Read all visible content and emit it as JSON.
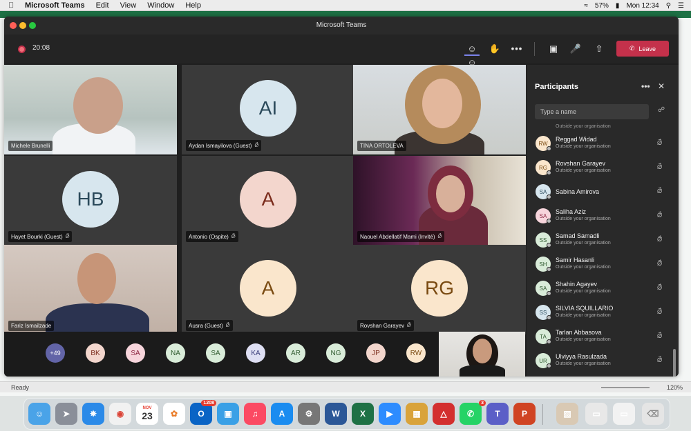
{
  "menubar": {
    "app_name": "Microsoft Teams",
    "menus": [
      "Edit",
      "View",
      "Window",
      "Help"
    ],
    "battery": "57%",
    "clock": "Mon 12:34"
  },
  "window": {
    "title": "Microsoft Teams"
  },
  "toolbar": {
    "timer": "20:08",
    "leave_label": "Leave"
  },
  "tiles": [
    {
      "name": "Michele Brunelli",
      "type": "video",
      "muted": false
    },
    {
      "name": "Aydan Ismayilova (Guest)",
      "type": "avatar",
      "initials": "AI",
      "muted": true,
      "bg": "#d7e6ee",
      "fg": "#2b4a5b"
    },
    {
      "name": "TINA ORTOLEVA",
      "type": "video",
      "muted": false
    },
    {
      "name": "Hayet Bourki (Guest)",
      "type": "avatar",
      "initials": "HB",
      "muted": true,
      "bg": "#d7e6ee",
      "fg": "#2b4a5b"
    },
    {
      "name": "Antonio (Ospite)",
      "type": "avatar",
      "initials": "A",
      "muted": true,
      "bg": "#f3d6cd",
      "fg": "#7a2b1b"
    },
    {
      "name": "Naouel Abdellatif Mami (Invité)",
      "type": "video",
      "muted": true
    },
    {
      "name": "Fariz Ismailzade",
      "type": "video",
      "muted": false
    },
    {
      "name": "Ausra (Guest)",
      "type": "avatar",
      "initials": "A",
      "muted": true,
      "bg": "#fae6cc",
      "fg": "#7a4b12"
    },
    {
      "name": "Rovshan Garayev",
      "type": "avatar",
      "initials": "RG",
      "muted": true,
      "bg": "#fae6cc",
      "fg": "#7a4b12"
    }
  ],
  "strip": {
    "overflow": "+49",
    "avatars": [
      {
        "initials": "BK",
        "bg": "#f3d6cd",
        "fg": "#7a2b1b"
      },
      {
        "initials": "SA",
        "bg": "#f7d5dc",
        "fg": "#8a2440"
      },
      {
        "initials": "NA",
        "bg": "#d9ecd9",
        "fg": "#2f5a2f"
      },
      {
        "initials": "SA",
        "bg": "#d9ecd9",
        "fg": "#2f5a2f"
      },
      {
        "initials": "KA",
        "bg": "#dedff3",
        "fg": "#3b3e7a"
      },
      {
        "initials": "AR",
        "bg": "#d9ecd9",
        "fg": "#2f5a2f"
      },
      {
        "initials": "NG",
        "bg": "#d9ecd9",
        "fg": "#2f5a2f"
      },
      {
        "initials": "JP",
        "bg": "#f3d6cd",
        "fg": "#7a2b1b"
      },
      {
        "initials": "RW",
        "bg": "#fae6cc",
        "fg": "#7a4b12"
      }
    ]
  },
  "panel": {
    "title": "Participants",
    "search_placeholder": "Type a name",
    "cut_off_text": "Outside your organisation",
    "participants": [
      {
        "initials": "RW",
        "name": "Reggad Widad",
        "sub": "Outside your organisation",
        "bg": "#fae6cc",
        "fg": "#7a4b12"
      },
      {
        "initials": "RG",
        "name": "Rovshan Garayev",
        "sub": "Outside your organisation",
        "bg": "#fae6cc",
        "fg": "#7a4b12"
      },
      {
        "initials": "SA",
        "name": "Sabina Amirova",
        "sub": "",
        "bg": "#d7e6ee",
        "fg": "#2b4a5b"
      },
      {
        "initials": "SA",
        "name": "Saliha Aziz",
        "sub": "Outside your organisation",
        "bg": "#f7d5dc",
        "fg": "#8a2440"
      },
      {
        "initials": "SS",
        "name": "Samad Samadli",
        "sub": "Outside your organisation",
        "bg": "#d9ecd9",
        "fg": "#2f5a2f"
      },
      {
        "initials": "SH",
        "name": "Samir Hasanli",
        "sub": "Outside your organisation",
        "bg": "#d9ecd9",
        "fg": "#2f5a2f"
      },
      {
        "initials": "SA",
        "name": "Shahin Agayev",
        "sub": "Outside your organisation",
        "bg": "#d9ecd9",
        "fg": "#2f5a2f"
      },
      {
        "initials": "SS",
        "name": "SILVIA SQUILLARIO",
        "sub": "Outside your organisation",
        "bg": "#d7e6ee",
        "fg": "#2b4a5b"
      },
      {
        "initials": "TA",
        "name": "Tarlan Abbasova",
        "sub": "Outside your organisation",
        "bg": "#d9ecd9",
        "fg": "#2f5a2f"
      },
      {
        "initials": "UR",
        "name": "Ulviyya Rasulzada",
        "sub": "Outside your organisation",
        "bg": "#d9ecd9",
        "fg": "#2f5a2f"
      }
    ]
  },
  "statusbar": {
    "ready": "Ready",
    "zoom": "120%"
  },
  "dock": {
    "outlook_badge": "1208",
    "whatsapp_badge": "3",
    "calendar_month": "NOV",
    "calendar_day": "23"
  }
}
